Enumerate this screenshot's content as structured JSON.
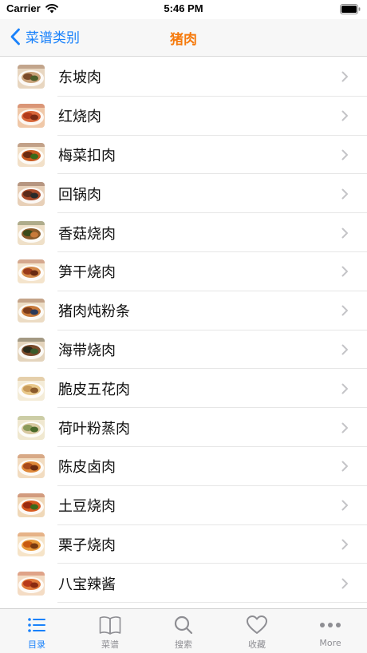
{
  "status_bar": {
    "carrier": "Carrier",
    "time": "5:46 PM"
  },
  "nav": {
    "back_label": "菜谱类别",
    "title": "猪肉"
  },
  "colors": {
    "accent": "#1a82fb",
    "title": "#f67a0c"
  },
  "dishes": [
    {
      "label": "东坡肉"
    },
    {
      "label": "红烧肉"
    },
    {
      "label": "梅菜扣肉"
    },
    {
      "label": "回锅肉"
    },
    {
      "label": "香菇烧肉"
    },
    {
      "label": "笋干烧肉"
    },
    {
      "label": "猪肉炖粉条"
    },
    {
      "label": "海带烧肉"
    },
    {
      "label": "脆皮五花肉"
    },
    {
      "label": "荷叶粉蒸肉"
    },
    {
      "label": "陈皮卤肉"
    },
    {
      "label": "土豆烧肉"
    },
    {
      "label": "栗子烧肉"
    },
    {
      "label": "八宝辣酱"
    }
  ],
  "tabs": [
    {
      "label": "目录",
      "icon": "list-icon",
      "active": true
    },
    {
      "label": "菜谱",
      "icon": "book-icon",
      "active": false
    },
    {
      "label": "搜索",
      "icon": "search-icon",
      "active": false
    },
    {
      "label": "收藏",
      "icon": "heart-icon",
      "active": false
    },
    {
      "label": "More",
      "icon": "more-icon",
      "active": false
    }
  ]
}
